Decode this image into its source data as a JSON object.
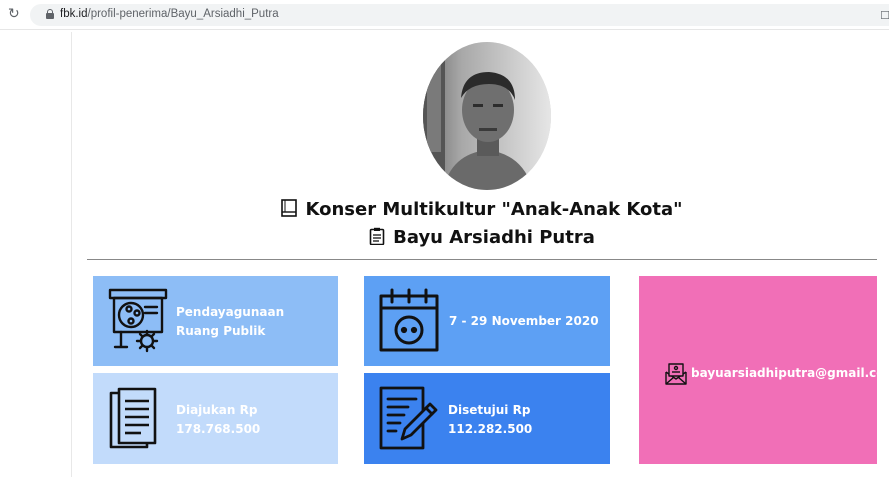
{
  "browser": {
    "url_host": "fbk.id",
    "url_path": "/profil-penerima/Bayu_Arsiadhi_Putra"
  },
  "profile": {
    "project_title": "Konser Multikultur \"Anak-Anak Kota\"",
    "name": "Bayu Arsiadhi Putra"
  },
  "cards": {
    "category": {
      "label": "Pendayagunaan Ruang Publik",
      "color": "#8dbdf6"
    },
    "date": {
      "label": "7 - 29 November 2020",
      "color": "#5da0f4"
    },
    "email": {
      "label": "bayuarsiadhiputra@gmail.co",
      "color": "#f16fb7"
    },
    "submitted": {
      "label": "Diajukan Rp",
      "amount": "178.768.500",
      "color": "#c2dbfb"
    },
    "approved": {
      "label": "Disetujui Rp",
      "amount": "112.282.500",
      "color": "#3b82ef"
    }
  },
  "icons": {
    "reload": "reload-icon",
    "lock": "lock-icon",
    "book": "book-icon",
    "clipboard": "clipboard-icon",
    "presentation": "presentation-gear-icon",
    "calendar": "calendar-icon",
    "document": "document-icon",
    "pen": "pen-document-icon",
    "mail": "envelope-icon"
  }
}
